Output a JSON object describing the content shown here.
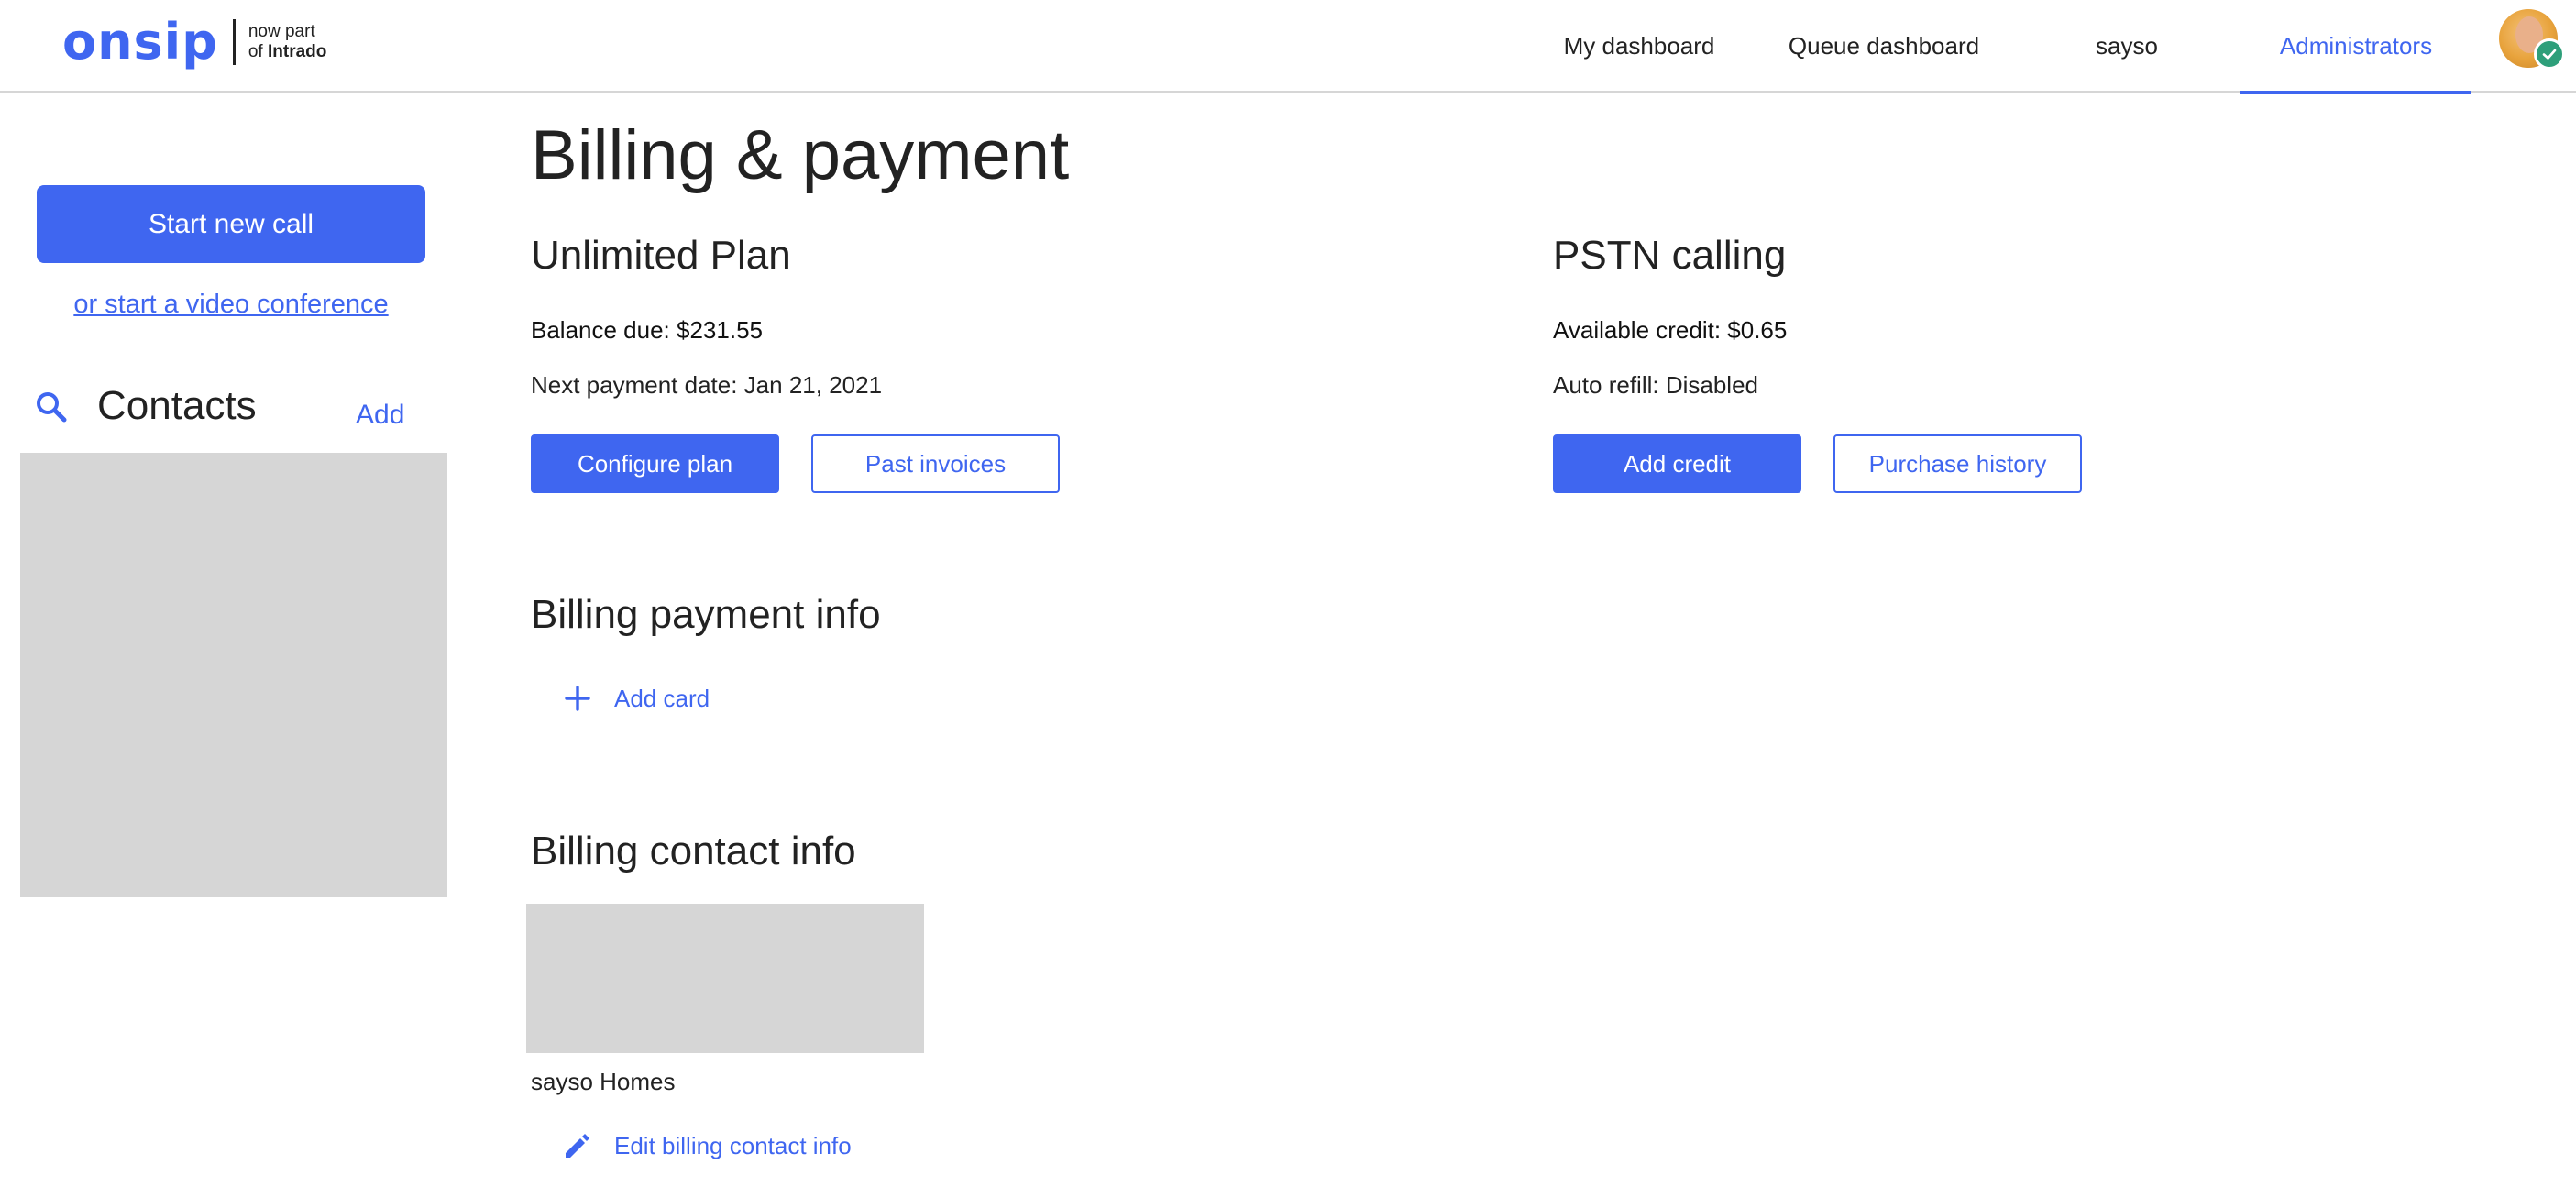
{
  "header": {
    "logo_word": "onsip",
    "logo_sub_line1": "now part",
    "logo_sub_of": "of",
    "logo_sub_brand": "Intrado",
    "nav": [
      {
        "label": "My dashboard",
        "active": false
      },
      {
        "label": "Queue dashboard",
        "active": false
      },
      {
        "label": "sayso",
        "active": false
      },
      {
        "label": "Administrators",
        "active": true
      }
    ],
    "avatar_status": "check-icon"
  },
  "sidebar": {
    "start_call_label": "Start new call",
    "video_link_label": "or start a video conference",
    "contacts_title": "Contacts",
    "contacts_add_label": "Add"
  },
  "main": {
    "page_title": "Billing & payment",
    "plan": {
      "title": "Unlimited Plan",
      "balance_due": "Balance due: $231.55",
      "next_payment": "Next payment date: Jan 21, 2021",
      "configure_label": "Configure plan",
      "invoices_label": "Past invoices"
    },
    "pstn": {
      "title": "PSTN calling",
      "available_credit": "Available credit: $0.65",
      "auto_refill": "Auto refill: Disabled",
      "add_credit_label": "Add credit",
      "history_label": "Purchase history"
    },
    "payment_info": {
      "title": "Billing payment info",
      "add_card_label": "Add card"
    },
    "contact_info": {
      "title": "Billing contact info",
      "company": "sayso Homes",
      "edit_label": "Edit billing contact info"
    }
  },
  "colors": {
    "accent": "#3f66f0",
    "placeholder": "#d6d6d6",
    "status_green": "#2e9f7a"
  }
}
